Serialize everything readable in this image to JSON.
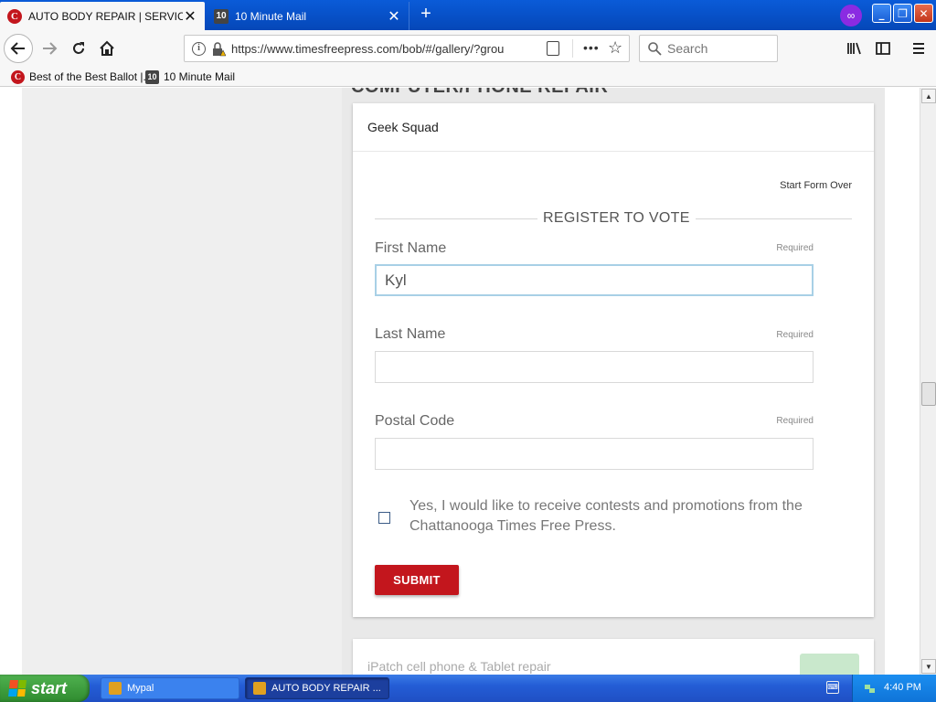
{
  "browser": {
    "tabs": [
      {
        "title": "AUTO BODY REPAIR | SERVICES",
        "favicon": "times-free-press-icon",
        "active": true
      },
      {
        "title": "10 Minute Mail",
        "favicon": "10-minute-mail-icon",
        "active": false
      }
    ],
    "url": "https://www.timesfreepress.com/bob/#/gallery/?grou",
    "search_placeholder": "Search",
    "bookmarks": [
      {
        "label": "Best of the Best Ballot |..."
      },
      {
        "label": "10 Minute Mail"
      }
    ],
    "favicon_letter": "C",
    "ten_icon_text": "10"
  },
  "page": {
    "section_heading": "COMPUTER/PHONE REPAIR",
    "card": {
      "title": "Geek Squad",
      "start_over": "Start Form Over",
      "form_heading": "REGISTER TO VOTE",
      "fields": {
        "first_name": {
          "label": "First Name",
          "required": "Required",
          "value": "Kyl"
        },
        "last_name": {
          "label": "Last Name",
          "required": "Required",
          "value": ""
        },
        "postal_code": {
          "label": "Postal Code",
          "required": "Required",
          "value": ""
        }
      },
      "promo_checkbox": {
        "checked": false,
        "label": "Yes, I would like to receive contests and promotions from the Chattanooga Times Free Press."
      },
      "submit_label": "SUBMIT"
    },
    "next_card": {
      "title": "iPatch cell phone & Tablet repair"
    }
  },
  "taskbar": {
    "start_label": "start",
    "tasks": [
      {
        "label": "Mypal"
      },
      {
        "label": "AUTO BODY REPAIR ..."
      }
    ],
    "clock": "4:40 PM"
  },
  "colors": {
    "brand_red": "#c3161d",
    "titlebar_blue": "#0a5bd8",
    "focus_border": "#a8d0e6"
  }
}
